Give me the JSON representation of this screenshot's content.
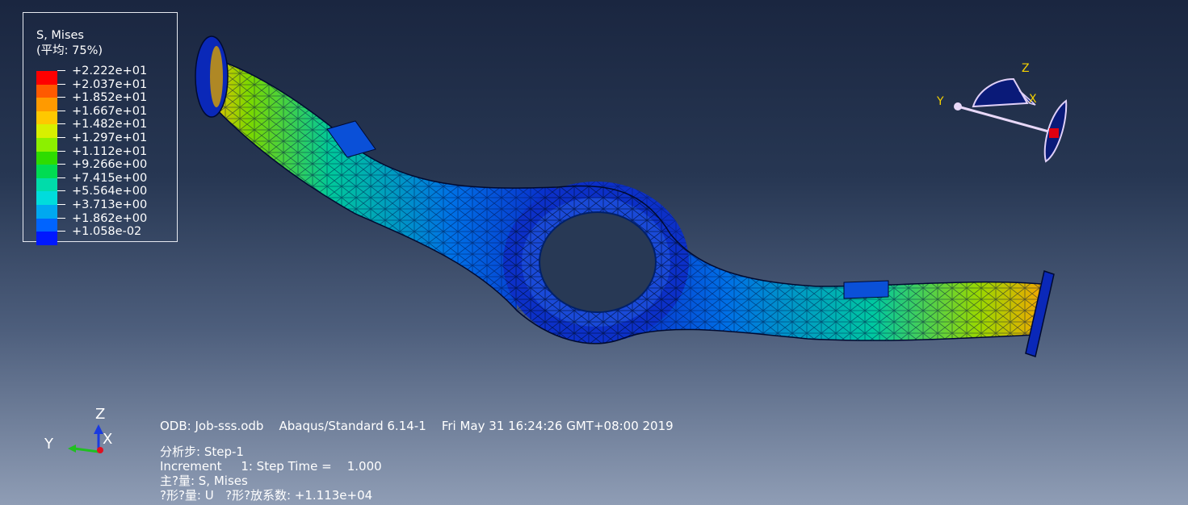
{
  "legend": {
    "title": "S, Mises",
    "averaging": "(平均: 75%)",
    "entries": [
      {
        "label": "+2.222e+01",
        "color": "#ff0000"
      },
      {
        "label": "+2.037e+01",
        "color": "#ff5a00"
      },
      {
        "label": "+1.852e+01",
        "color": "#ff9a00"
      },
      {
        "label": "+1.667e+01",
        "color": "#ffc800"
      },
      {
        "label": "+1.482e+01",
        "color": "#d8f000"
      },
      {
        "label": "+1.297e+01",
        "color": "#8cf000"
      },
      {
        "label": "+1.112e+01",
        "color": "#2edc00"
      },
      {
        "label": "+9.266e+00",
        "color": "#00dc52"
      },
      {
        "label": "+7.415e+00",
        "color": "#00dcaa"
      },
      {
        "label": "+5.564e+00",
        "color": "#00dcdc"
      },
      {
        "label": "+3.713e+00",
        "color": "#00a8f0"
      },
      {
        "label": "+1.862e+00",
        "color": "#0064ff"
      },
      {
        "label": "+1.058e-02",
        "color": "#0018ff"
      }
    ]
  },
  "triad": {
    "z": "Z",
    "x": "X",
    "y": "Y"
  },
  "csys": {
    "z": "Z",
    "x": "X",
    "y": "Y"
  },
  "info": {
    "odb_line": "ODB: Job-sss.odb    Abaqus/Standard 6.14-1    Fri May 31 16:24:26 GMT+08:00 2019",
    "step": "分析步: Step-1",
    "increment": "Increment     1: Step Time =    1.000",
    "primary": "主?量: S, Mises",
    "deformed": "?形?量: U   ?形?放系数: +1.113e+04"
  },
  "colors": {
    "background_top": "#1a2640",
    "background_bottom": "#8f9db5",
    "mesh_base": "#0a28c8"
  }
}
